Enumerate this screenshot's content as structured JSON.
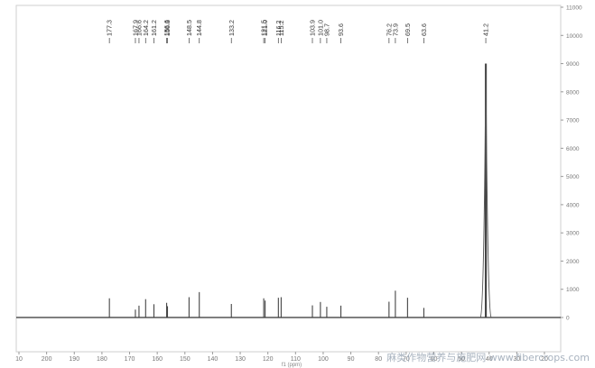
{
  "chart_data": {
    "type": "line",
    "title": "",
    "xlabel": "f1 (ppm)",
    "ylabel": "",
    "x_reversed": true,
    "xlim": [
      210,
      20
    ],
    "ylim": [
      -1200,
      11000
    ],
    "x_ticks": [
      "10",
      "200",
      "190",
      "180",
      "170",
      "160",
      "150",
      "140",
      "130",
      "120",
      "110",
      "100",
      "90",
      "80",
      "70",
      "60",
      "50",
      "40",
      "30",
      "20"
    ],
    "y_ticks": [
      0,
      1000,
      2000,
      3000,
      4000,
      5000,
      6000,
      7000,
      8000,
      9000,
      10000,
      11000
    ],
    "y_tick_labels": [
      "0",
      "1000",
      "2000",
      "3000",
      "4000",
      "5000",
      "6000",
      "7000",
      "8000",
      "9000",
      "10000",
      "11000"
    ],
    "grid": true,
    "peak_labels": [
      "177.3",
      "167.9",
      "166.6",
      "164.2",
      "161.2",
      "156.6",
      "156.3",
      "148.5",
      "144.8",
      "133.2",
      "121.5",
      "121.0",
      "116.2",
      "115.2",
      "103.9",
      "101.0",
      "98.7",
      "93.6",
      "76.2",
      "73.9",
      "69.5",
      "63.6",
      "41.2"
    ],
    "peaks": [
      {
        "x": 177.3,
        "y": 680
      },
      {
        "x": 167.9,
        "y": 280
      },
      {
        "x": 166.6,
        "y": 420
      },
      {
        "x": 164.2,
        "y": 650
      },
      {
        "x": 161.2,
        "y": 470
      },
      {
        "x": 156.6,
        "y": 520
      },
      {
        "x": 156.3,
        "y": 400
      },
      {
        "x": 148.5,
        "y": 720
      },
      {
        "x": 144.8,
        "y": 900
      },
      {
        "x": 133.2,
        "y": 480
      },
      {
        "x": 121.5,
        "y": 680
      },
      {
        "x": 121.0,
        "y": 600
      },
      {
        "x": 116.2,
        "y": 700
      },
      {
        "x": 115.2,
        "y": 720
      },
      {
        "x": 103.9,
        "y": 430
      },
      {
        "x": 101.0,
        "y": 550
      },
      {
        "x": 98.7,
        "y": 380
      },
      {
        "x": 93.6,
        "y": 420
      },
      {
        "x": 76.2,
        "y": 560
      },
      {
        "x": 73.9,
        "y": 950
      },
      {
        "x": 69.5,
        "y": 700
      },
      {
        "x": 63.6,
        "y": 340
      },
      {
        "x": 41.2,
        "y": 9000
      }
    ]
  },
  "watermark": "麻类作物营养与施肥网 www.fibercrops.com"
}
